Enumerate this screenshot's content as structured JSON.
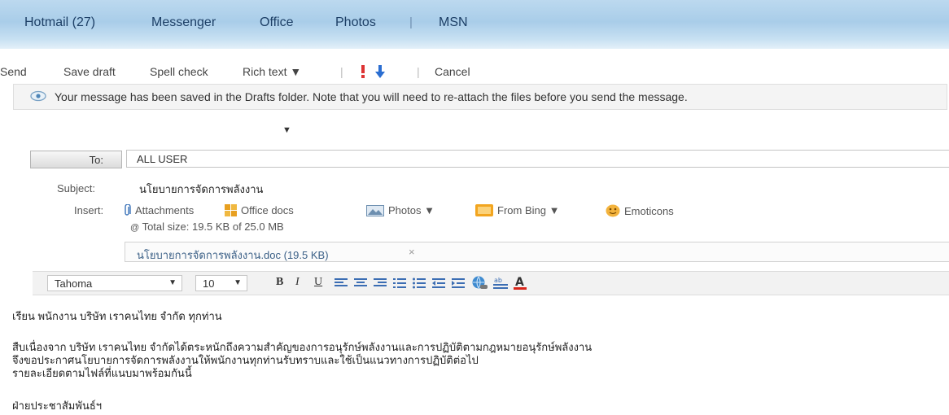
{
  "nav": {
    "items": [
      "Hotmail (27)",
      "Messenger",
      "Office",
      "Photos",
      "MSN"
    ],
    "separator": "|"
  },
  "toolbar": {
    "send": "Send",
    "save_draft": "Save draft",
    "spell_check": "Spell check",
    "rich_text": "Rich text ▼",
    "cancel": "Cancel"
  },
  "info": {
    "message": "Your message has been saved in the Drafts folder. Note that you will need to re-attach the files before you send the message."
  },
  "compose": {
    "from_arrow": "▼",
    "to_label": "To:",
    "to_value": "ALL USER",
    "subject_label": "Subject:",
    "subject_value": "นโยบายการจัดการพลังงาน",
    "insert_label": "Insert:",
    "insert_items": [
      "Attachments",
      "Office docs",
      "Photos ▼",
      "From Bing ▼",
      "Emoticons"
    ],
    "total_size": "Total size: 19.5 KB of 25.0 MB",
    "attachment": {
      "name": "นโยบายการจัดการพลังงาน.doc (19.5 KB)",
      "remove": "×"
    }
  },
  "format": {
    "font": "Tahoma",
    "size": "10"
  },
  "body": {
    "lines": [
      "เรียน พนักงาน บริษัท เราคนไทย จำกัด ทุกท่าน",
      "สืบเนื่องจาก บริษัท เราคนไทย จำกัดได้ตระหนักถึงความสำคัญของการอนุรักษ์พลังงานและการปฏิบัติตามกฎหมายอนุรักษ์พลังงาน",
      "จึงขอประกาศนโยบายการจัดการพลังงานให้พนักงานทุกท่านรับทราบและใช้เป็นแนวทางการปฏิบัติต่อไป",
      "รายละเอียดตามไฟล์ที่แนบมาพร้อมกันนี้",
      "ฝ่ายประชาสัมพันธ์ฯ"
    ]
  },
  "colors": {
    "nav_bg": "#b0d2ec",
    "link_blue": "#1d3f66",
    "priority_red": "#d33",
    "priority_blue": "#2b6ed1"
  }
}
